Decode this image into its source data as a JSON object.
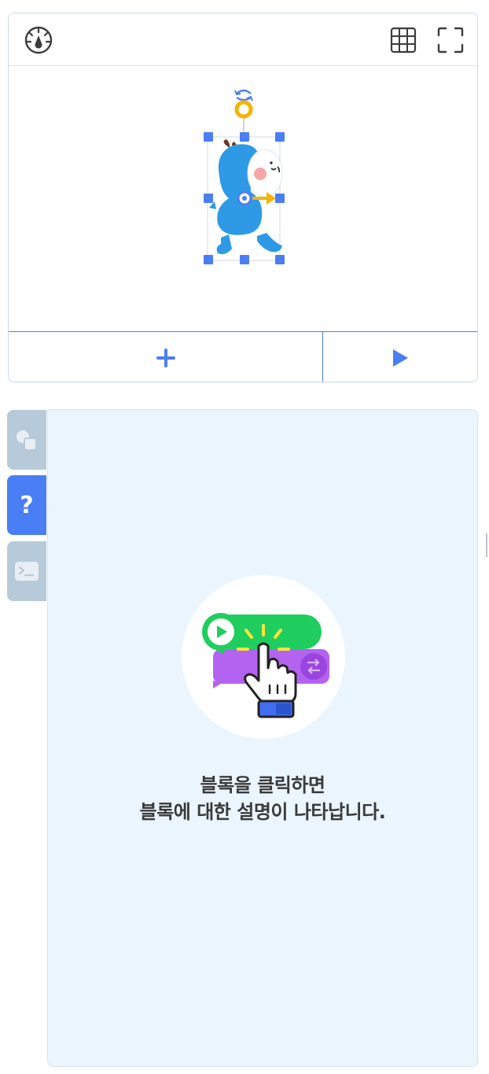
{
  "stage": {
    "toolbar": {
      "speed_icon": "speedometer-icon",
      "grid_icon": "grid-icon",
      "fullscreen_icon": "fullscreen-icon"
    },
    "sprite": {
      "name": "entrybot",
      "selected": true
    },
    "bottom": {
      "add_icon": "plus-icon",
      "play_icon": "play-icon"
    },
    "colors": {
      "accent": "#4a7ee6",
      "handle": "#4a7ef4",
      "rotate": "#f5b400"
    }
  },
  "side_tabs": [
    {
      "id": "objects",
      "icon": "objects-icon",
      "active": false
    },
    {
      "id": "help",
      "icon": "question-icon",
      "label": "?",
      "active": true
    },
    {
      "id": "console",
      "icon": "console-icon",
      "active": false
    }
  ],
  "help": {
    "line1": "블록을 클릭하면",
    "line2": "블록에 대한 설명이 나타납니다.",
    "illustration": "block-click-illustration"
  }
}
